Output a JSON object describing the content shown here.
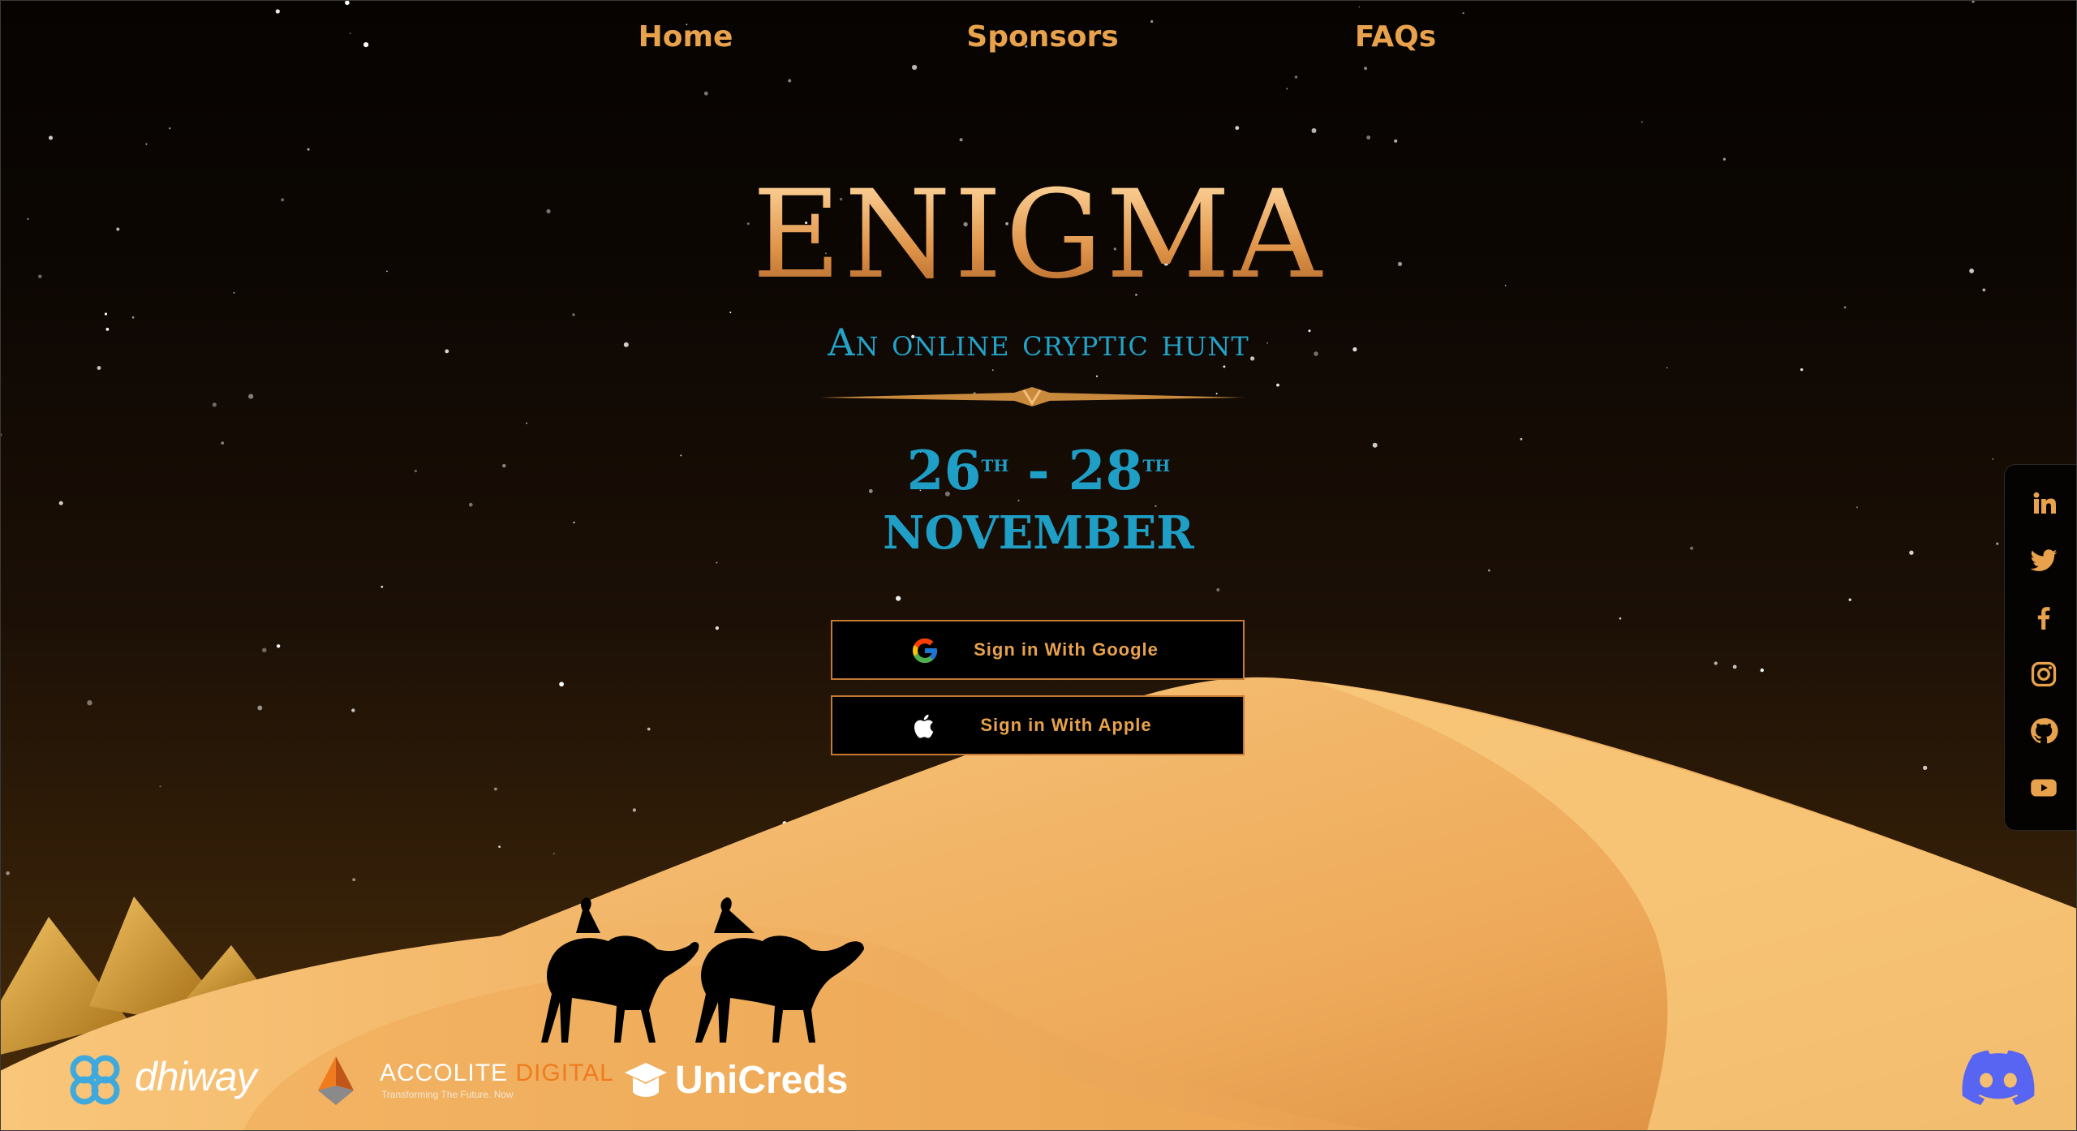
{
  "nav": {
    "home": "Home",
    "sponsors": "Sponsors",
    "faqs": "FAQs"
  },
  "hero": {
    "title": "ENIGMA",
    "subtitle": "An online cryptic hunt",
    "date_start": "26",
    "date_start_suffix": "TH",
    "date_sep": " - ",
    "date_end": "28",
    "date_end_suffix": "TH",
    "month": "NOVEMBER"
  },
  "auth": {
    "google_label": "Sign in With Google",
    "apple_label": "Sign in With Apple"
  },
  "social_icons": [
    "linkedin-icon",
    "twitter-icon",
    "facebook-icon",
    "instagram-icon",
    "github-icon",
    "youtube-icon"
  ],
  "sponsors": {
    "dhiway": "dhiway",
    "accolite_main": "ACCOLITE",
    "accolite_accent": "DIGITAL",
    "accolite_tagline": "Transforming The Future. Now",
    "unicreds": "UniCreds"
  },
  "colors": {
    "accent_orange": "#e8a24c",
    "accent_blue": "#1f9ec6",
    "sand": "#f2b866",
    "discord": "#5865f2"
  }
}
